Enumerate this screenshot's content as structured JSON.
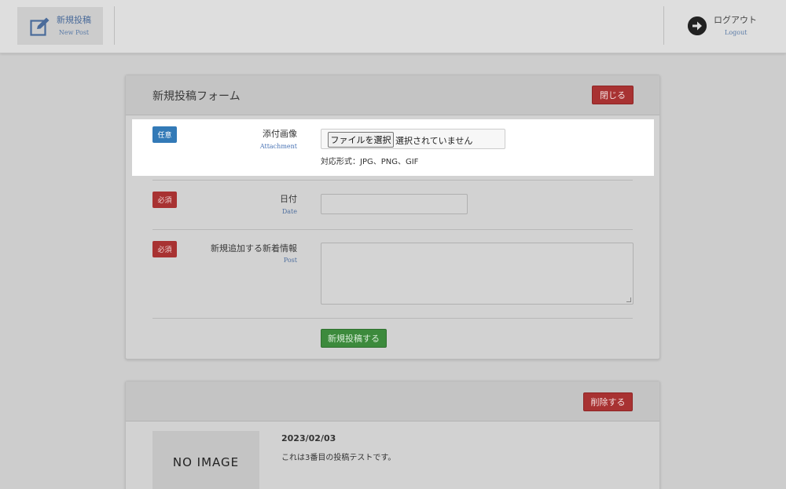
{
  "header": {
    "new_post_label": "新規投稿",
    "new_post_sub": "New Post",
    "logout_label": "ログアウト",
    "logout_sub": "Logout"
  },
  "form": {
    "title": "新規投稿フォーム",
    "close_label": "閉じる",
    "attachment": {
      "badge": "任意",
      "label": "添付画像",
      "sub": "Attachment",
      "file_button": "ファイルを選択",
      "file_status": "選択されていません",
      "hint": "対応形式：JPG、PNG、GIF"
    },
    "date": {
      "badge": "必須",
      "label": "日付",
      "sub": "Date",
      "value": ""
    },
    "post": {
      "badge": "必須",
      "label": "新規追加する新着情報",
      "sub": "Post",
      "value": ""
    },
    "submit_label": "新規投稿する"
  },
  "post_list": {
    "delete_label": "削除する",
    "items": [
      {
        "image_placeholder": "NO IMAGE",
        "date": "2023/02/03",
        "text": "これは3番目の投稿テストです。"
      }
    ]
  },
  "colors": {
    "required_badge": "#a83232",
    "optional_badge": "#337ab7",
    "submit": "#3c8a3c"
  }
}
